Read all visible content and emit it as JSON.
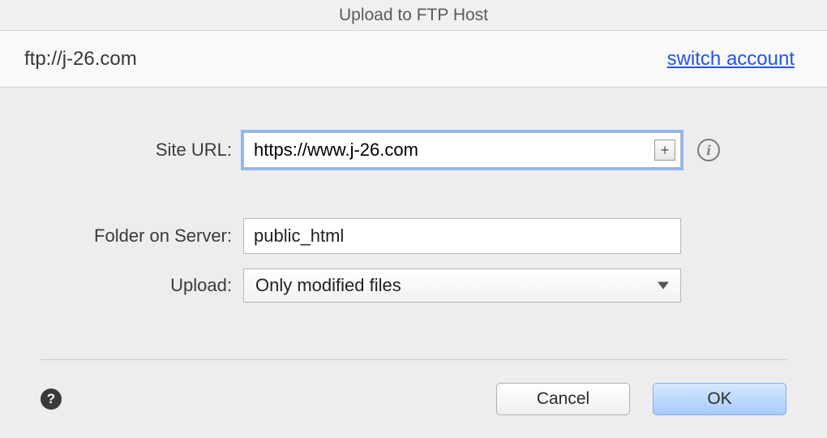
{
  "window": {
    "title": "Upload to FTP Host"
  },
  "header": {
    "host": "ftp://j-26.com",
    "switch_label": "switch account"
  },
  "form": {
    "site_url": {
      "label": "Site URL:",
      "value": "https://www.j-26.com"
    },
    "folder": {
      "label": "Folder on Server:",
      "value": "public_html"
    },
    "upload": {
      "label": "Upload:",
      "selected": "Only modified files"
    }
  },
  "buttons": {
    "cancel": "Cancel",
    "ok": "OK"
  },
  "icons": {
    "plus": "+",
    "info": "i",
    "help": "?"
  }
}
